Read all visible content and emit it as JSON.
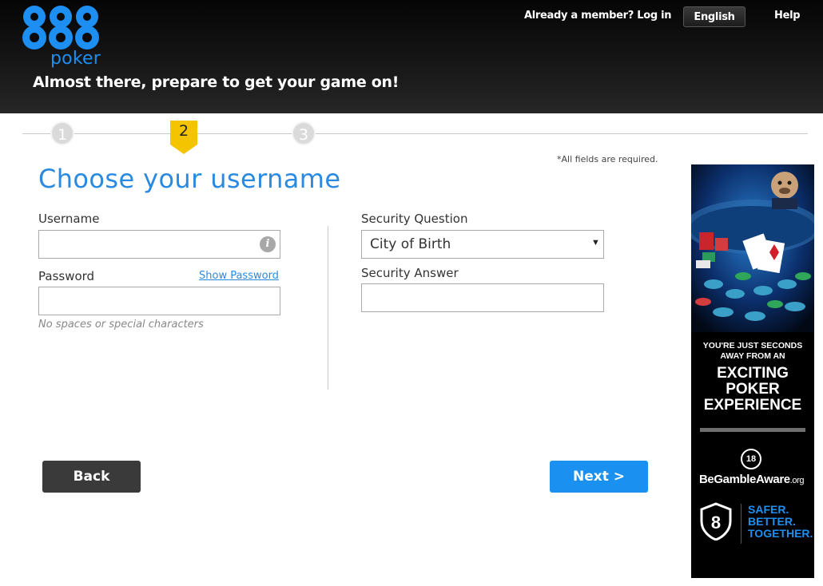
{
  "header": {
    "logo_digits": "888",
    "logo_text": "poker",
    "tagline": "Almost there, prepare to get your game on!",
    "login_link": "Already a member? Log in",
    "language": "English",
    "help": "Help"
  },
  "stepper": {
    "steps": [
      {
        "number": "1",
        "state": "inactive"
      },
      {
        "number": "2",
        "state": "active"
      },
      {
        "number": "3",
        "state": "inactive"
      }
    ],
    "accent_color": "#f4c400"
  },
  "form": {
    "required_note": "*All fields are required.",
    "title": "Choose your username",
    "username_label": "Username",
    "username_value": "",
    "info_glyph": "i",
    "password_label": "Password",
    "password_value": "",
    "show_password": "Show Password",
    "password_hint": "No spaces or special characters",
    "security_question_label": "Security Question",
    "security_question_value": "City of Birth",
    "security_answer_label": "Security Answer",
    "security_answer_value": ""
  },
  "buttons": {
    "back": "Back",
    "next": "Next >"
  },
  "ad": {
    "line1": "YOU'RE JUST SECONDS",
    "line2": "AWAY FROM AN",
    "big1": "EXCITING",
    "big2": "POKER",
    "big3": "EXPERIENCE",
    "age": "18",
    "bga_main": "BeGambleAware",
    "bga_suffix": ".org",
    "shield_digit": "8",
    "safer1": "SAFER.",
    "safer2": "BETTER.",
    "safer3": "TOGETHER."
  },
  "colors": {
    "brand_blue": "#1a90f0",
    "title_blue": "#2a8ae0",
    "back_button": "#3a3a3a"
  }
}
